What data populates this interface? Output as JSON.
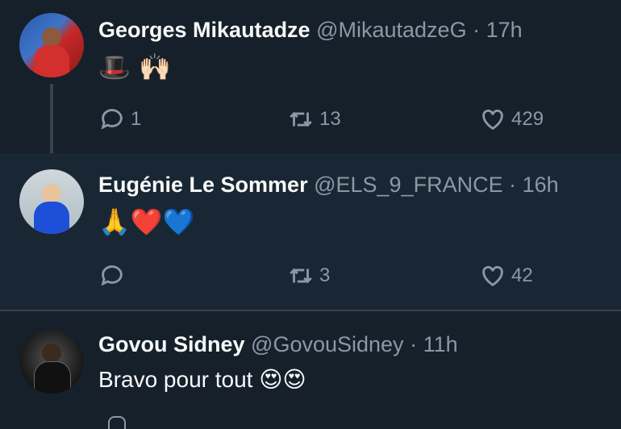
{
  "tweets": [
    {
      "name": "Georges Mikautadze",
      "handle": "@MikautadzeG",
      "sep": "·",
      "time": "17h",
      "content": "🎩 🙌🏻",
      "replies": "1",
      "retweets": "13",
      "likes": "429"
    },
    {
      "name": "Eugénie Le Sommer",
      "handle": "@ELS_9_FRANCE",
      "sep": "·",
      "time": "16h",
      "content": "🙏❤️💙",
      "replies": "",
      "retweets": "3",
      "likes": "42"
    },
    {
      "name": "Govou Sidney",
      "handle": "@GovouSidney",
      "sep": "·",
      "time": "11h",
      "content": "Bravo pour tout 😍😍"
    }
  ],
  "icons": {
    "reply": "reply-icon",
    "retweet": "retweet-icon",
    "like": "heart-icon"
  },
  "colors": {
    "background": "#15202b",
    "highlighted_background": "#192734",
    "secondary_text": "#8b98a5",
    "primary_text": "#f7f9f9",
    "divider": "#38444d"
  }
}
